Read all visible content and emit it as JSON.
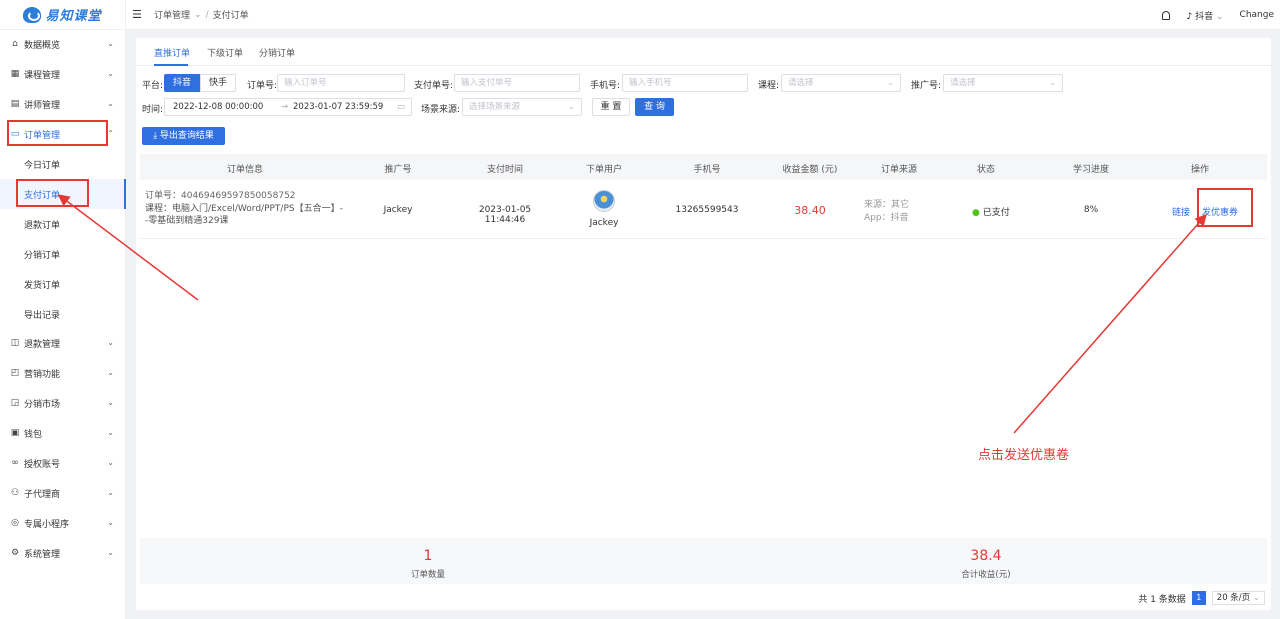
{
  "brand": {
    "name": "易知课堂"
  },
  "sidebar": {
    "items": [
      {
        "label": "数据概览",
        "icon": "home-icon"
      },
      {
        "label": "课程管理",
        "icon": "grid-icon"
      },
      {
        "label": "讲师管理",
        "icon": "id-card-icon"
      },
      {
        "label": "订单管理",
        "icon": "monitor-icon"
      },
      {
        "label": "退款管理",
        "icon": "refund-icon"
      },
      {
        "label": "营销功能",
        "icon": "bag-icon"
      },
      {
        "label": "分销市场",
        "icon": "shop-icon"
      },
      {
        "label": "钱包",
        "icon": "wallet-icon"
      },
      {
        "label": "授权账号",
        "icon": "link-icon"
      },
      {
        "label": "子代理商",
        "icon": "users-icon"
      },
      {
        "label": "专属小程序",
        "icon": "app-icon"
      },
      {
        "label": "系统管理",
        "icon": "gear-icon"
      }
    ],
    "sub_items": [
      {
        "label": "今日订单"
      },
      {
        "label": "支付订单"
      },
      {
        "label": "退款订单"
      },
      {
        "label": "分销订单"
      },
      {
        "label": "发货订单"
      },
      {
        "label": "导出记录"
      }
    ]
  },
  "topbar": {
    "breadcrumb": [
      "订单管理",
      "支付订单"
    ],
    "platform": "抖音",
    "user": "Change"
  },
  "tabs": [
    {
      "label": "直推订单"
    },
    {
      "label": "下级订单"
    },
    {
      "label": "分销订单"
    }
  ],
  "filters": {
    "platform_label": "平台:",
    "platform_options": [
      "抖音",
      "快手"
    ],
    "order_no_label": "订单号:",
    "order_no_placeholder": "输入订单号",
    "pay_no_label": "支付单号:",
    "pay_no_placeholder": "输入支付单号",
    "phone_label": "手机号:",
    "phone_placeholder": "输入手机号",
    "course_label": "课程:",
    "course_placeholder": "请选择",
    "promo_label": "推广号:",
    "promo_placeholder": "请选择",
    "time_label": "时间:",
    "time_start": "2022-12-08 00:00:00",
    "time_sep": "→",
    "time_end": "2023-01-07 23:59:59",
    "scene_label": "场景来源:",
    "scene_placeholder": "选择场景来源",
    "reset_label": "重 置",
    "search_label": "查 询",
    "export_label": "导出查询结果"
  },
  "table": {
    "columns": [
      "订单信息",
      "推广号",
      "支付时间",
      "下单用户",
      "手机号",
      "收益金额 (元)",
      "订单来源",
      "状态",
      "学习进度",
      "操作"
    ],
    "rows": [
      {
        "order_no": "订单号：40469469597850058752",
        "course": "课程：电脑入门/Excel/Word/PPT/PS【五合一】--零基础到精通329课",
        "promoter": "Jackey",
        "pay_time": "2023-01-05 11:44:46",
        "user": "Jackey",
        "phone": "13265599543",
        "amount": "38.40",
        "source": "来源：其它",
        "app": "App：抖音",
        "status": "已支付",
        "progress": "8%",
        "action_link": "链接",
        "action_coupon": "发优惠券"
      }
    ]
  },
  "summary": {
    "order_count": "1",
    "order_count_label": "订单数量",
    "total_income": "38.4",
    "total_income_label": "合计收益(元)"
  },
  "pagination": {
    "total": "共 1 条数据",
    "page": "1",
    "page_size": "20 条/页"
  },
  "annotation": "点击发送优惠卷",
  "colors": {
    "accent": "#2f6fe0",
    "highlight": "#e53935",
    "status_ok": "#52c41a"
  }
}
